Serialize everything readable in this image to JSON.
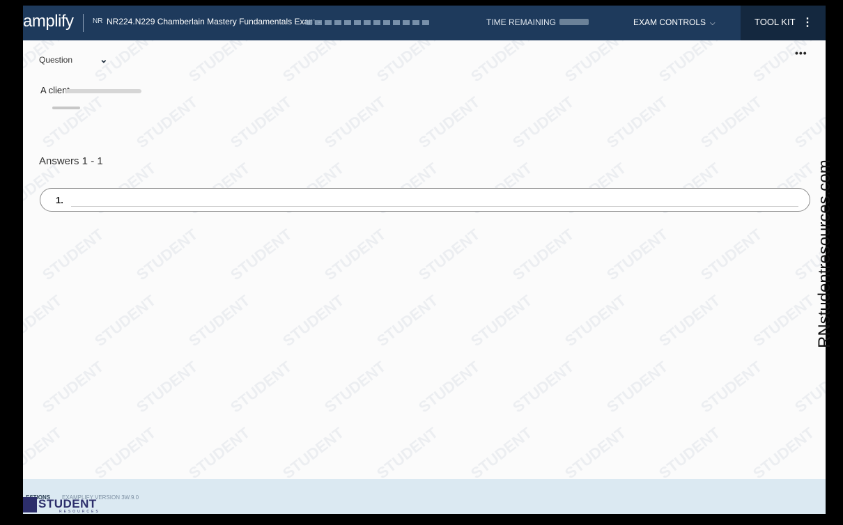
{
  "header": {
    "logo": "amplify",
    "exam_code_icon": "NR",
    "exam_title": "NR224.N229 Chamberlain Mastery Fundamentals Exam -",
    "time_label": "TIME REMAINING",
    "exam_controls_label": "EXAM CONTROLS",
    "toolkit_label": "TOOL KIT"
  },
  "question": {
    "label": "Question",
    "text": "A client"
  },
  "answers": {
    "heading": "Answers 1 - 1",
    "items": [
      {
        "number": "1."
      }
    ]
  },
  "footer": {
    "questions_label": "ESTIONS",
    "version": "EXAMPLIFY VERSION 3W.9.0"
  },
  "watermark": {
    "text": "STUDENT"
  },
  "overlay": {
    "brand_name": "STUDENT",
    "brand_sub": "RESOURCES",
    "side_text": "RNstudentresources.com"
  },
  "colors": {
    "header_bg": "#1e3a5c",
    "toolkit_bg": "#14283f",
    "footer_bg": "#dbe9f2",
    "brand": "#2c2e6b"
  }
}
